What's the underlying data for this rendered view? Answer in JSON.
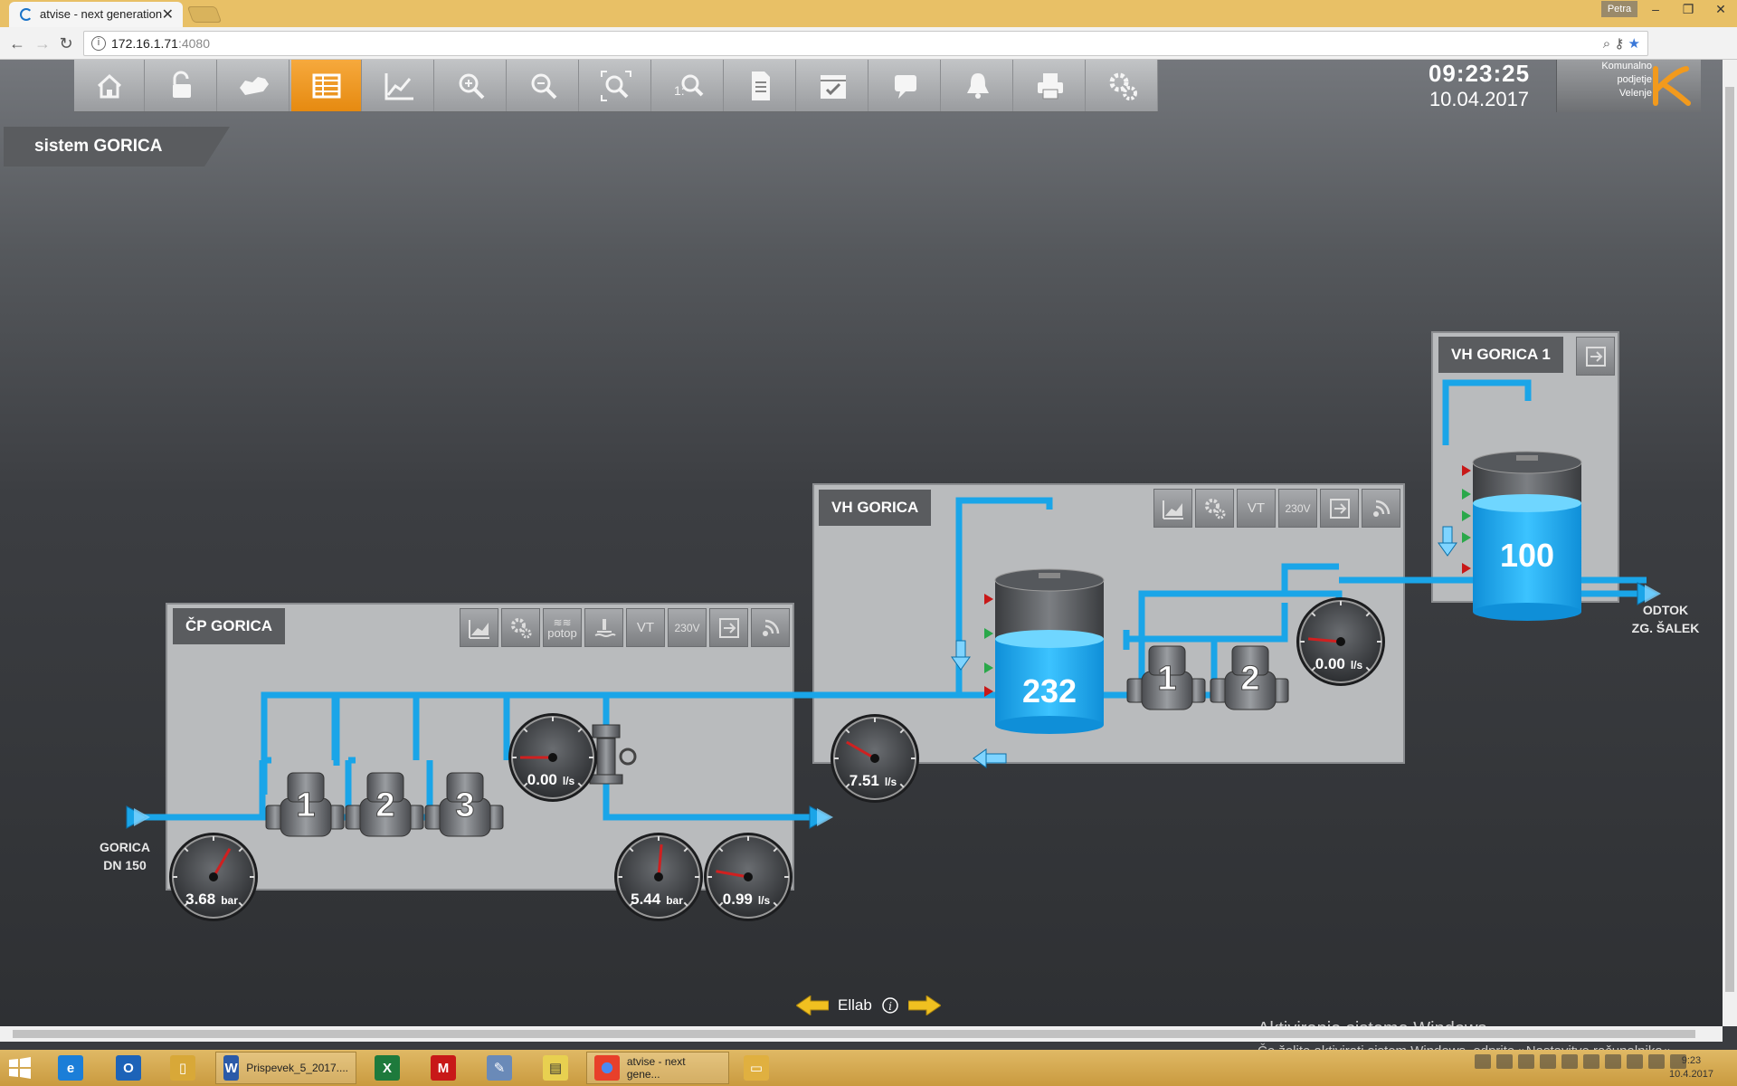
{
  "browser": {
    "tab_title": "atvise - next generation",
    "tab_close": "✕",
    "profile": "Petra",
    "url_host": "172.16.1.71",
    "url_port": ":4080"
  },
  "toolbar": {
    "items": [
      {
        "name": "home-icon"
      },
      {
        "name": "unlock-icon"
      },
      {
        "name": "map-icon"
      },
      {
        "name": "table-icon",
        "active": true
      },
      {
        "name": "chart-icon"
      },
      {
        "name": "zoom-in-icon"
      },
      {
        "name": "zoom-out-icon"
      },
      {
        "name": "zoom-fit-icon"
      },
      {
        "name": "zoom-reset-icon"
      },
      {
        "name": "document-icon"
      },
      {
        "name": "calendar-icon"
      },
      {
        "name": "messages-icon"
      },
      {
        "name": "alarm-bell-icon"
      },
      {
        "name": "print-icon"
      },
      {
        "name": "settings-icon"
      }
    ],
    "zoom_reset_label": "1:"
  },
  "clock": {
    "time": "09:23:25",
    "date": "10.04.2017"
  },
  "brand": {
    "line1": "Komunalno",
    "line2": "podjetje",
    "line3": "Velenje"
  },
  "page": {
    "title": "sistem GORICA"
  },
  "cp_gorica": {
    "title": "ČP GORICA",
    "icons": [
      "trend-icon",
      "settings-icon",
      "potop",
      "flood-icon",
      "VT",
      "230V",
      "exit-icon",
      "signal-icon"
    ],
    "potop_label": "potop",
    "vt_label": "VT",
    "v230_label": "230V",
    "pumps": [
      "1",
      "2",
      "3"
    ],
    "gauge_in": {
      "value": "3.68",
      "unit": "bar"
    },
    "gauge_flow": {
      "value": "0.00",
      "unit": "l/s"
    },
    "gauge_out_p": {
      "value": "5.44",
      "unit": "bar"
    },
    "gauge_out_q": {
      "value": "0.99",
      "unit": "l/s"
    }
  },
  "vh_gorica": {
    "title": "VH GORICA",
    "vt_label": "VT",
    "v230_label": "230V",
    "tank_level": "232",
    "pumps": [
      "1",
      "2"
    ],
    "gauge_in": {
      "value": "7.51",
      "unit": "l/s"
    },
    "gauge_out": {
      "value": "0.00",
      "unit": "l/s"
    }
  },
  "vh_gorica1": {
    "title": "VH GORICA 1",
    "tank_level": "100"
  },
  "labels": {
    "inlet_line1": "GORICA",
    "inlet_line2": "DN 150",
    "outlet_line1": "ODTOK",
    "outlet_line2": "ZG. ŠALEK"
  },
  "bottom_nav": {
    "label": "Ellab"
  },
  "watermark": {
    "line1": "Aktiviranje sistema Windows",
    "line2": "Če želite aktivirati sistem Windows, odprite »Nastavitve računalnika«."
  },
  "taskbar": {
    "word_task": "Prispevek_5_2017....",
    "chrome_task": "atvise - next gene...",
    "time": "9:23",
    "date": "10.4.2017"
  },
  "colors": {
    "pipe": "#1aa5e8",
    "accent": "#f29a1d",
    "panel": "#b9bbbd"
  }
}
